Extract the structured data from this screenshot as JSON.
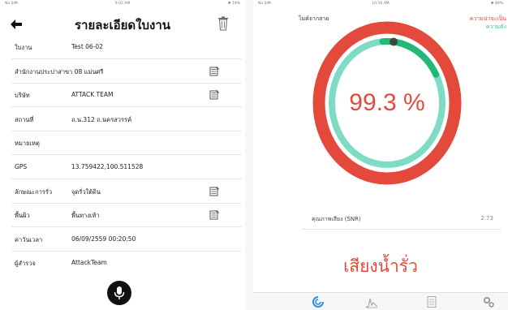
{
  "left": {
    "statusbar": {
      "left": "No SIM",
      "center": "9:02 AM",
      "right": "✱ 19%"
    },
    "header": {
      "title": "รายละเอียดใบงาน"
    },
    "rows": [
      {
        "label": "ใบงาน",
        "value": "Test 06-02",
        "has_icon": false
      },
      {
        "label": "สำนักงานประปาสาขา 08 แม่นศรี",
        "value": "",
        "has_icon": true
      },
      {
        "label": "บริษัท",
        "value": "ATTACK TEAM",
        "has_icon": true
      },
      {
        "label": "สถานที่",
        "value": "ถ.น.312 ถ.นครสวรรค์",
        "has_icon": false
      },
      {
        "label": "หมายเหตุ",
        "value": "",
        "has_icon": false
      },
      {
        "label": "GPS",
        "value": "13.759422,100.511528",
        "has_icon": false
      },
      {
        "label": "ลักษณะการรั่ว",
        "value": "จุดรั่วใต้ดิน",
        "has_icon": true
      },
      {
        "label": "พื้นผิว",
        "value": "พื้นทางเท้า",
        "has_icon": true
      },
      {
        "label": "ค่าวันเวลา",
        "value": "06/09/2559 00:20:50",
        "has_icon": false
      },
      {
        "label": "ผู้สำรวจ",
        "value": "AttackTeam",
        "has_icon": false
      }
    ]
  },
  "right": {
    "statusbar": {
      "left": "No SIM",
      "center": "10:16 AM",
      "right": "✱ 89%"
    },
    "wireless_label": "ไมค์จากสาย",
    "legend": {
      "a": "ความน่าจะเป็น",
      "b": "ความดัง"
    },
    "gauge": {
      "percent_label": "99.3 %",
      "probability": 0.993,
      "loudness": 0.12
    },
    "snr": {
      "label": "คุณภาพเสียง (SNR)",
      "value": "2.73"
    },
    "result": "เสียงน้ำรั่ว",
    "colors": {
      "red": "#e34a3c",
      "teal": "#7fdcc4",
      "green": "#22b878",
      "blue": "#2d8ee0"
    }
  }
}
